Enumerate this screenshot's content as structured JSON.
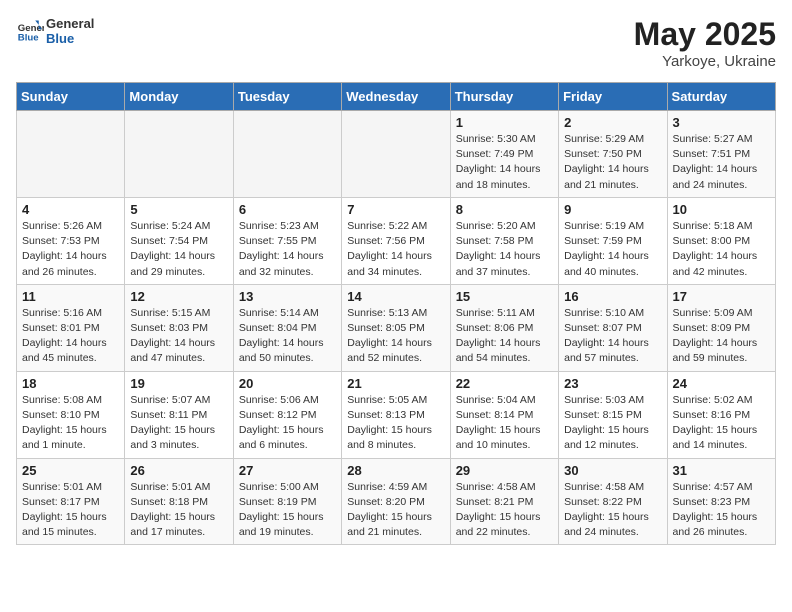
{
  "header": {
    "logo_general": "General",
    "logo_blue": "Blue",
    "month_year": "May 2025",
    "location": "Yarkoye, Ukraine"
  },
  "days_of_week": [
    "Sunday",
    "Monday",
    "Tuesday",
    "Wednesday",
    "Thursday",
    "Friday",
    "Saturday"
  ],
  "weeks": [
    [
      {
        "day": "",
        "info": ""
      },
      {
        "day": "",
        "info": ""
      },
      {
        "day": "",
        "info": ""
      },
      {
        "day": "",
        "info": ""
      },
      {
        "day": "1",
        "info": "Sunrise: 5:30 AM\nSunset: 7:49 PM\nDaylight: 14 hours\nand 18 minutes."
      },
      {
        "day": "2",
        "info": "Sunrise: 5:29 AM\nSunset: 7:50 PM\nDaylight: 14 hours\nand 21 minutes."
      },
      {
        "day": "3",
        "info": "Sunrise: 5:27 AM\nSunset: 7:51 PM\nDaylight: 14 hours\nand 24 minutes."
      }
    ],
    [
      {
        "day": "4",
        "info": "Sunrise: 5:26 AM\nSunset: 7:53 PM\nDaylight: 14 hours\nand 26 minutes."
      },
      {
        "day": "5",
        "info": "Sunrise: 5:24 AM\nSunset: 7:54 PM\nDaylight: 14 hours\nand 29 minutes."
      },
      {
        "day": "6",
        "info": "Sunrise: 5:23 AM\nSunset: 7:55 PM\nDaylight: 14 hours\nand 32 minutes."
      },
      {
        "day": "7",
        "info": "Sunrise: 5:22 AM\nSunset: 7:56 PM\nDaylight: 14 hours\nand 34 minutes."
      },
      {
        "day": "8",
        "info": "Sunrise: 5:20 AM\nSunset: 7:58 PM\nDaylight: 14 hours\nand 37 minutes."
      },
      {
        "day": "9",
        "info": "Sunrise: 5:19 AM\nSunset: 7:59 PM\nDaylight: 14 hours\nand 40 minutes."
      },
      {
        "day": "10",
        "info": "Sunrise: 5:18 AM\nSunset: 8:00 PM\nDaylight: 14 hours\nand 42 minutes."
      }
    ],
    [
      {
        "day": "11",
        "info": "Sunrise: 5:16 AM\nSunset: 8:01 PM\nDaylight: 14 hours\nand 45 minutes."
      },
      {
        "day": "12",
        "info": "Sunrise: 5:15 AM\nSunset: 8:03 PM\nDaylight: 14 hours\nand 47 minutes."
      },
      {
        "day": "13",
        "info": "Sunrise: 5:14 AM\nSunset: 8:04 PM\nDaylight: 14 hours\nand 50 minutes."
      },
      {
        "day": "14",
        "info": "Sunrise: 5:13 AM\nSunset: 8:05 PM\nDaylight: 14 hours\nand 52 minutes."
      },
      {
        "day": "15",
        "info": "Sunrise: 5:11 AM\nSunset: 8:06 PM\nDaylight: 14 hours\nand 54 minutes."
      },
      {
        "day": "16",
        "info": "Sunrise: 5:10 AM\nSunset: 8:07 PM\nDaylight: 14 hours\nand 57 minutes."
      },
      {
        "day": "17",
        "info": "Sunrise: 5:09 AM\nSunset: 8:09 PM\nDaylight: 14 hours\nand 59 minutes."
      }
    ],
    [
      {
        "day": "18",
        "info": "Sunrise: 5:08 AM\nSunset: 8:10 PM\nDaylight: 15 hours\nand 1 minute."
      },
      {
        "day": "19",
        "info": "Sunrise: 5:07 AM\nSunset: 8:11 PM\nDaylight: 15 hours\nand 3 minutes."
      },
      {
        "day": "20",
        "info": "Sunrise: 5:06 AM\nSunset: 8:12 PM\nDaylight: 15 hours\nand 6 minutes."
      },
      {
        "day": "21",
        "info": "Sunrise: 5:05 AM\nSunset: 8:13 PM\nDaylight: 15 hours\nand 8 minutes."
      },
      {
        "day": "22",
        "info": "Sunrise: 5:04 AM\nSunset: 8:14 PM\nDaylight: 15 hours\nand 10 minutes."
      },
      {
        "day": "23",
        "info": "Sunrise: 5:03 AM\nSunset: 8:15 PM\nDaylight: 15 hours\nand 12 minutes."
      },
      {
        "day": "24",
        "info": "Sunrise: 5:02 AM\nSunset: 8:16 PM\nDaylight: 15 hours\nand 14 minutes."
      }
    ],
    [
      {
        "day": "25",
        "info": "Sunrise: 5:01 AM\nSunset: 8:17 PM\nDaylight: 15 hours\nand 15 minutes."
      },
      {
        "day": "26",
        "info": "Sunrise: 5:01 AM\nSunset: 8:18 PM\nDaylight: 15 hours\nand 17 minutes."
      },
      {
        "day": "27",
        "info": "Sunrise: 5:00 AM\nSunset: 8:19 PM\nDaylight: 15 hours\nand 19 minutes."
      },
      {
        "day": "28",
        "info": "Sunrise: 4:59 AM\nSunset: 8:20 PM\nDaylight: 15 hours\nand 21 minutes."
      },
      {
        "day": "29",
        "info": "Sunrise: 4:58 AM\nSunset: 8:21 PM\nDaylight: 15 hours\nand 22 minutes."
      },
      {
        "day": "30",
        "info": "Sunrise: 4:58 AM\nSunset: 8:22 PM\nDaylight: 15 hours\nand 24 minutes."
      },
      {
        "day": "31",
        "info": "Sunrise: 4:57 AM\nSunset: 8:23 PM\nDaylight: 15 hours\nand 26 minutes."
      }
    ]
  ]
}
